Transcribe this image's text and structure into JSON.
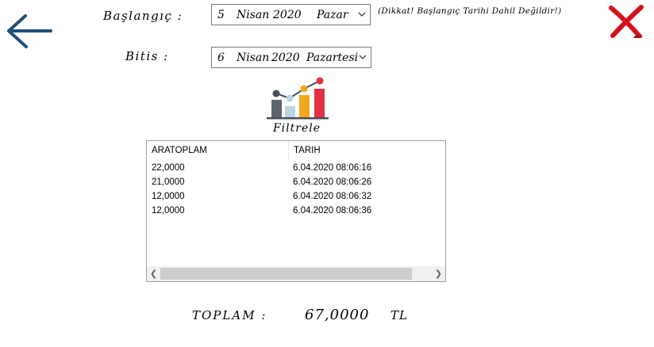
{
  "nav": {
    "back_icon": "arrow-left-icon",
    "close_icon": "close-x-icon",
    "close_color": "#d3121c",
    "back_color": "#1f4f7a"
  },
  "start": {
    "label": "Başlangıç :",
    "day": "5",
    "month": "Nisan",
    "year": "2020",
    "weekday": "Pazar"
  },
  "end": {
    "label": "Bitis :",
    "day": "6",
    "month": "Nisan",
    "year": "2020",
    "weekday": "Pazartesi"
  },
  "note": "(Dikkat! Başlangıç Tarihi Dahil Değildir!)",
  "filter": {
    "label": "Filtrele",
    "icon": "bar-chart-icon"
  },
  "grid": {
    "columns": [
      "ARATOPLAM",
      "TARIH"
    ],
    "rows": [
      [
        "22,0000",
        "6.04.2020 08:06:16"
      ],
      [
        "21,0000",
        "6.04.2020 08:06:26"
      ],
      [
        "12,0000",
        "6.04.2020 08:06:32"
      ],
      [
        "12,0000",
        "6.04.2020 08:06:36"
      ]
    ]
  },
  "total": {
    "label": "TOPLAM :",
    "value": "67,0000",
    "unit": "TL"
  }
}
